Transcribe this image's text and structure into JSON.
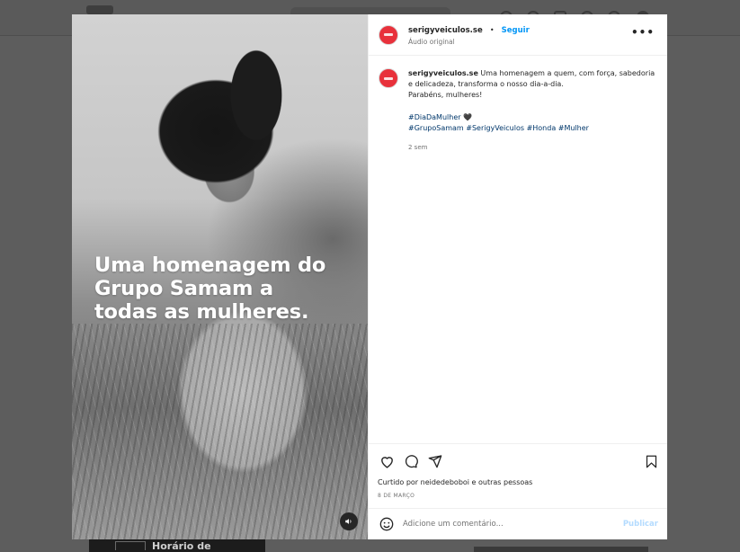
{
  "background": {
    "card_label": "Horário de"
  },
  "post": {
    "media": {
      "caption_lines": [
        "Uma homenagem do",
        "Grupo Samam a",
        "todas as mulheres."
      ]
    },
    "header": {
      "username": "serigyveiculos.se",
      "separator": "•",
      "follow_label": "Seguir",
      "audio_label": "Áudio original",
      "more_label": "•••"
    },
    "caption": {
      "username": "serigyveiculos.se",
      "text": "Uma homenagem a quem, com força, sabedoria e delicadeza, transforma o nosso dia-a-dia.",
      "line2": "Parabéns, mulheres!",
      "hashtags_line1": "#DiaDaMulher 🖤",
      "hashtags_line2": "#GrupoSamam #SerigyVeiculos #Honda #Mulher",
      "time_ago": "2 sem"
    },
    "actions": {
      "liked_by": "Curtido por neidedeboboi e outras pessoas",
      "date": "8 DE MARÇO"
    },
    "comment_box": {
      "placeholder": "Adicione um comentário...",
      "publish_label": "Publicar"
    }
  },
  "colors": {
    "brand_red": "#e8313b",
    "link_blue": "#0095f6",
    "hashtag_blue": "#00376b",
    "publish_disabled": "#b3dbff"
  },
  "icons": [
    "heart-icon",
    "comment-icon",
    "share-icon",
    "bookmark-icon",
    "emoji-icon",
    "volume-icon",
    "more-icon"
  ]
}
